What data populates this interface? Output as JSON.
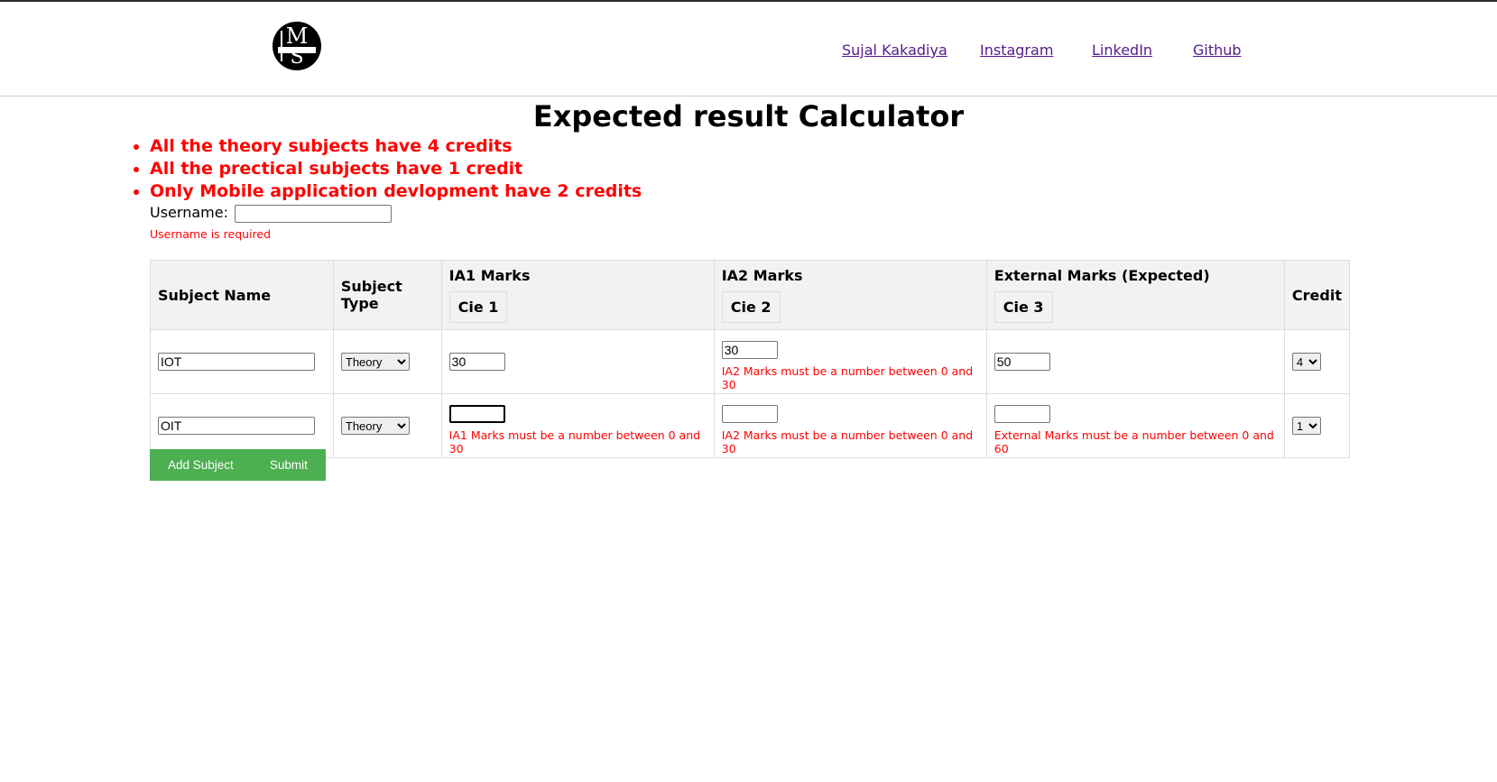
{
  "nav": {
    "logo_text": "IMS KAKADIYA",
    "links": [
      "Sujal Kakadiya",
      "Instagram",
      "LinkedIn",
      "Github"
    ]
  },
  "title": "Expected result Calculator",
  "rules": [
    "All the theory subjects have 4 credits",
    "All the prectical subjects have 1 credit",
    "Only Mobile application devlopment have 2 credits"
  ],
  "username": {
    "label": "Username:",
    "value": "",
    "error": "Username is required"
  },
  "table": {
    "headers": {
      "subject_name": "Subject Name",
      "subject_type": "Subject Type",
      "ia1": "IA1 Marks",
      "ia1_sub": "Cie 1",
      "ia2": "IA2 Marks",
      "ia2_sub": "Cie 2",
      "external": "External Marks (Expected)",
      "external_sub": "Cie 3",
      "credit": "Credit"
    },
    "rows": [
      {
        "name": "IOT",
        "type": "Theory",
        "ia1": "30",
        "ia1_error": "",
        "ia2": "30",
        "ia2_error": "IA2 Marks must be a number between 0 and 30",
        "external": "50",
        "external_error": "",
        "credit": "4"
      },
      {
        "name": "OIT",
        "type": "Theory",
        "ia1": "",
        "ia1_error": "IA1 Marks must be a number between 0 and 30",
        "ia2": "",
        "ia2_error": "IA2 Marks must be a number between 0 and 30",
        "external": "",
        "external_error": "External Marks must be a number between 0 and 60",
        "credit": "1"
      }
    ]
  },
  "buttons": {
    "add": "Add Subject",
    "submit": "Submit"
  }
}
